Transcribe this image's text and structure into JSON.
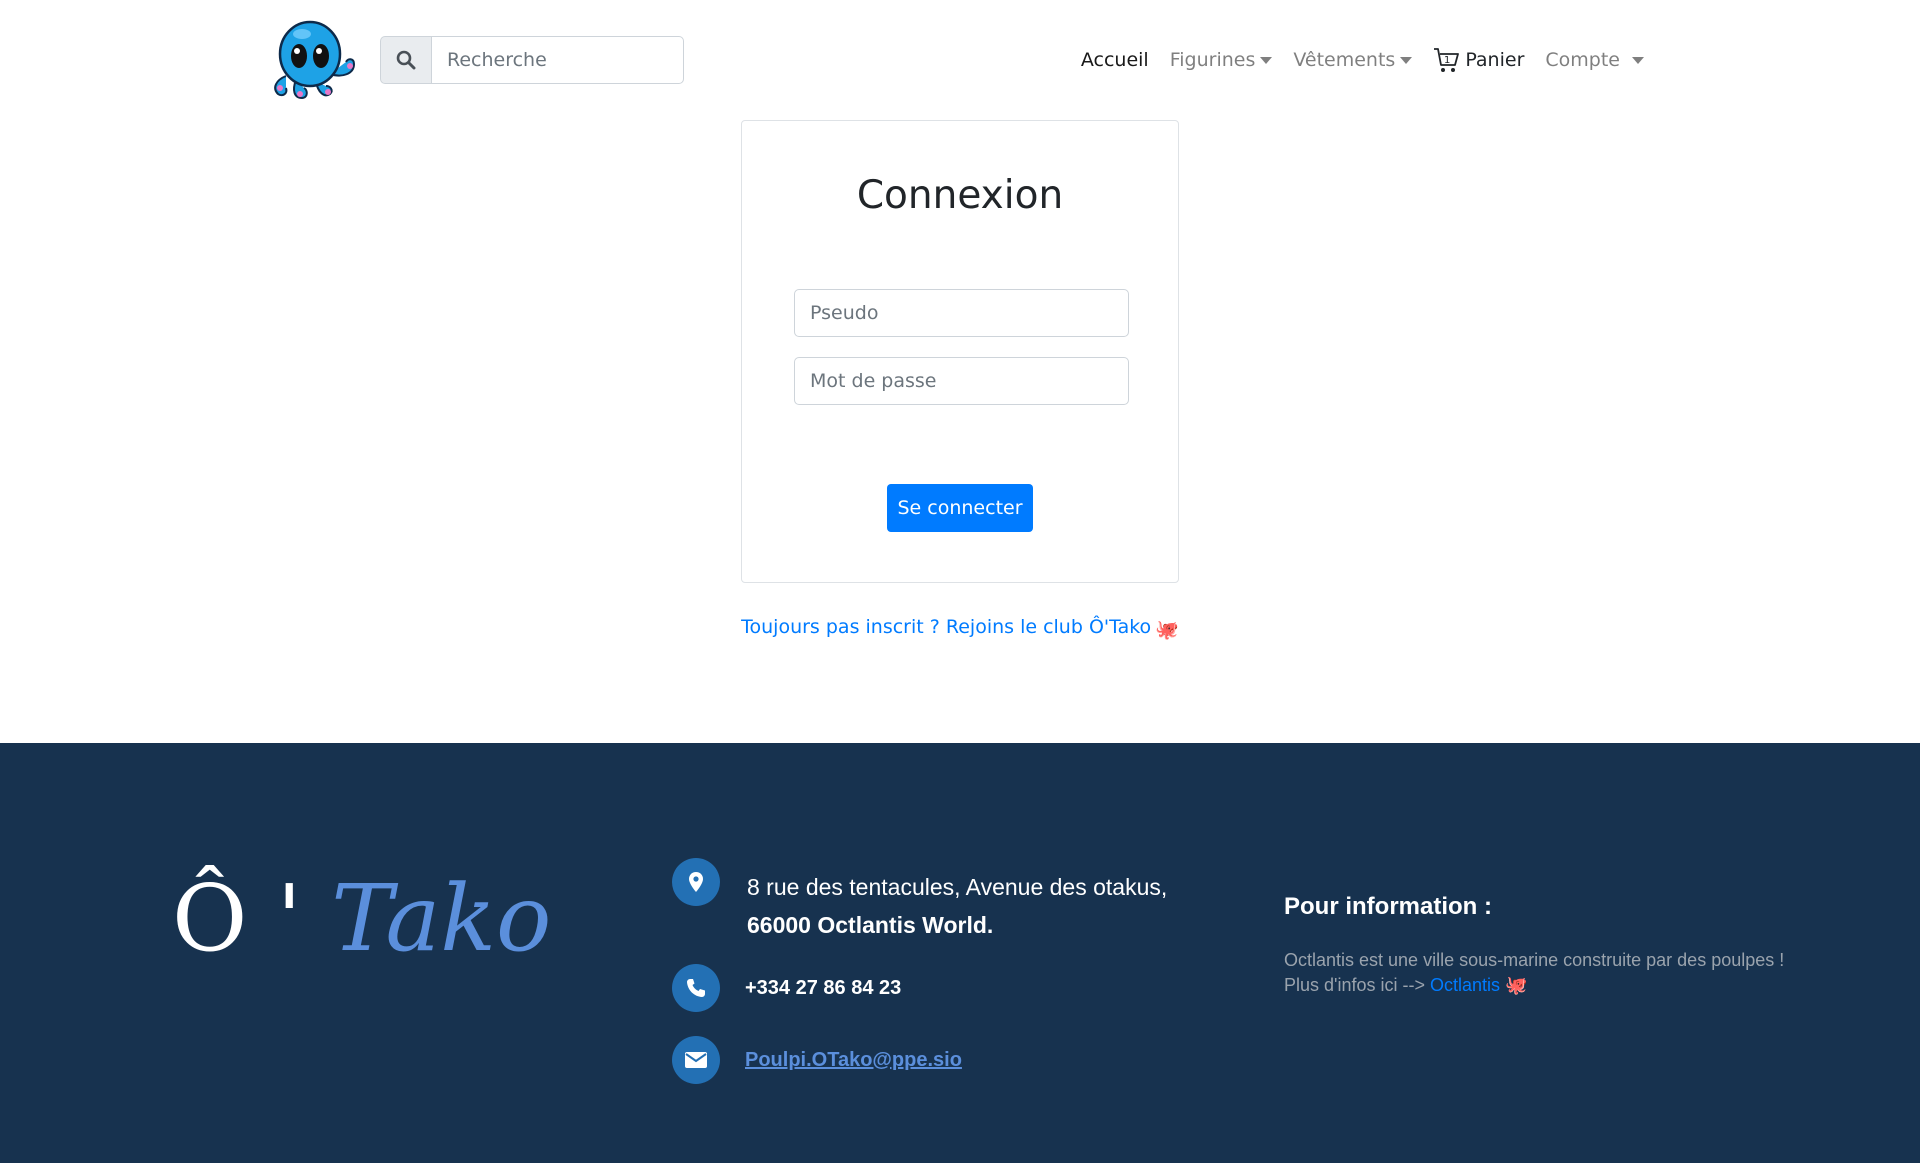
{
  "nav": {
    "search_placeholder": "Recherche",
    "items": {
      "accueil": "Accueil",
      "figurines": "Figurines",
      "vetements": "Vêtements",
      "panier": "Panier",
      "compte": "Compte"
    }
  },
  "login": {
    "title": "Connexion",
    "pseudo_placeholder": "Pseudo",
    "password_placeholder": "Mot de passe",
    "submit_label": "Se connecter",
    "register_text": "Toujours pas inscrit ? Rejoins le club Ô'Tako",
    "register_emoji": "🐙"
  },
  "footer": {
    "brand_o": "Ô '",
    "brand_tako": "Tako",
    "address_line1": "8 rue des tentacules, Avenue des otakus,",
    "address_line2": "66000 Octlantis World.",
    "phone": "+334 27 86 84 23",
    "email": "Poulpi.OTako@ppe.sio",
    "info_title": "Pour information :",
    "info_line1": "Octlantis est une ville sous-marine construite par des poulpes !",
    "info_line2_prefix": "Plus d'infos ici -->",
    "info_link": "Octlantis",
    "info_emoji": "🐙"
  },
  "colors": {
    "primary": "#007bff",
    "footer_bg": "#17324f",
    "icon_circle": "#2370b4",
    "brand_accent": "#5b8fdc"
  },
  "icons": [
    "octopus-logo",
    "search-icon",
    "cart-icon",
    "map-pin-icon",
    "phone-icon",
    "envelope-icon"
  ]
}
